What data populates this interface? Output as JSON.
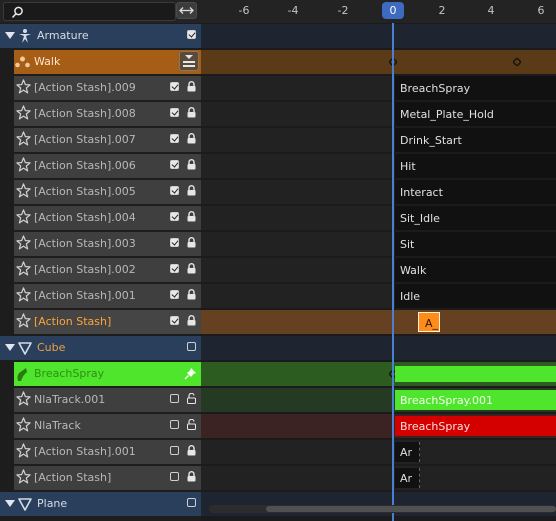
{
  "topbar": {
    "search": {
      "placeholder": ""
    },
    "swap_icon": "arrows-horizontal-icon"
  },
  "ruler": {
    "ticks": [
      "-6",
      "-4",
      "-2",
      "0",
      "2",
      "4",
      "6"
    ],
    "current_frame": "0"
  },
  "tracks": {
    "armature": {
      "label": "Armature"
    },
    "walk": {
      "label": "Walk"
    },
    "stash": [
      {
        "label": "[Action Stash].009",
        "strip": "BreachSpray"
      },
      {
        "label": "[Action Stash].008",
        "strip": "Metal_Plate_Hold"
      },
      {
        "label": "[Action Stash].007",
        "strip": "Drink_Start"
      },
      {
        "label": "[Action Stash].006",
        "strip": "Hit"
      },
      {
        "label": "[Action Stash].005",
        "strip": "Interact"
      },
      {
        "label": "[Action Stash].004",
        "strip": "Sit_Idle"
      },
      {
        "label": "[Action Stash].003",
        "strip": "Sit"
      },
      {
        "label": "[Action Stash].002",
        "strip": "Walk"
      },
      {
        "label": "[Action Stash].001",
        "strip": "Idle"
      }
    ],
    "action_stash": {
      "label": "[Action Stash]",
      "strip": "A_"
    },
    "cube": {
      "label": "Cube"
    },
    "breachspray": {
      "label": "BreachSpray"
    },
    "nlatrack001": {
      "label": "NlaTrack.001",
      "strip": "BreachSpray.001"
    },
    "nlatrack": {
      "label": "NlaTrack",
      "strip": "BreachSpray"
    },
    "cube_stash001": {
      "label": "[Action Stash].001",
      "strip": "Ar"
    },
    "cube_stash": {
      "label": "[Action Stash]",
      "strip": "Ar"
    },
    "plane": {
      "label": "Plane"
    }
  },
  "colors": {
    "accent": "#3d6bbf",
    "orange": "#e0822a",
    "green": "#4ee62b",
    "red": "#d40000",
    "object_row": "#2a3f5b"
  }
}
